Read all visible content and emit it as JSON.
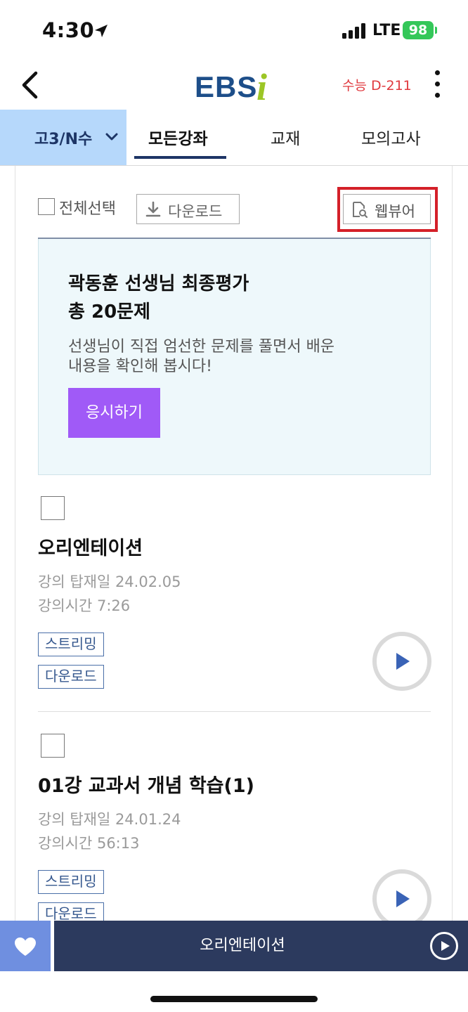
{
  "status_bar": {
    "time": "4:30",
    "network": "LTE",
    "battery": "98",
    "icons": [
      "location-arrow-icon",
      "signal-bars-icon",
      "battery-charging-icon"
    ]
  },
  "header": {
    "logo_text": "EBSi",
    "dday": "수능 D-211",
    "icons": [
      "back-chevron-icon",
      "more-vertical-icon"
    ],
    "colors": {
      "logo_blue": "#1d4e89",
      "logo_green": "#9cc626",
      "dday_red": "#e0393e"
    }
  },
  "tabs": {
    "grade_label": "고3/N수",
    "items": [
      {
        "label": "모든강좌",
        "active": true
      },
      {
        "label": "교재",
        "active": false
      },
      {
        "label": "모의고사",
        "active": false
      }
    ],
    "colors": {
      "grade_bg": "#b6d8fb",
      "active_underline": "#1d3566"
    }
  },
  "toolbar": {
    "select_all_label": "전체선택",
    "download_label": "다운로드",
    "webviewer_label": "웹뷰어",
    "highlight_color": "#d42029"
  },
  "promo": {
    "title_line1": "곽동훈 선생님 최종평가",
    "title_line2": "총 20문제",
    "desc_line1": "선생님이 직접 엄선한 문제를 풀면서 배운",
    "desc_line2": "내용을 확인해 봅시다!",
    "button_label": "응시하기",
    "colors": {
      "bg": "#eef8fb",
      "button": "#a05af7"
    }
  },
  "lectures": [
    {
      "title": "오리엔테이션",
      "upload_date": "강의 탑재일 24.02.05",
      "duration": "강의시간 7:26",
      "tags": [
        "스트리밍",
        "다운로드"
      ]
    },
    {
      "title": "01강 교과서 개념 학습(1)",
      "upload_date": "강의 탑재일 24.01.24",
      "duration": "강의시간 56:13",
      "tags": [
        "스트리밍",
        "다운로드"
      ]
    }
  ],
  "mini_player": {
    "title": "오리엔테이션",
    "icons": [
      "heart-icon",
      "play-circle-icon"
    ],
    "colors": {
      "bar": "#2c3a5e",
      "fav": "#6f8fe0"
    }
  }
}
